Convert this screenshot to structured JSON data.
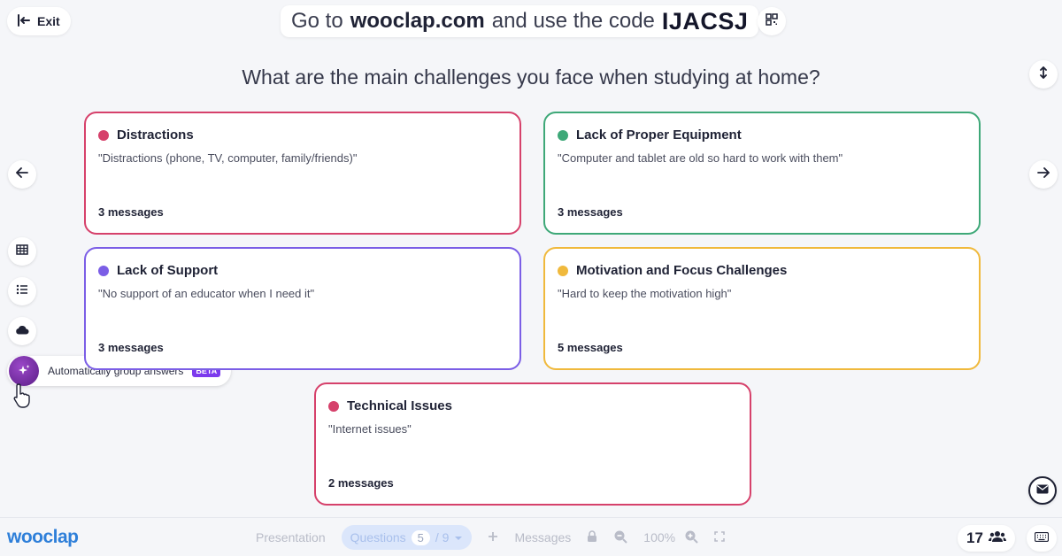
{
  "header": {
    "exit_label": "Exit",
    "code_prefix": "Go to",
    "code_site": "wooclap.com",
    "code_middle": "and use the code",
    "code": "IJACSJ"
  },
  "question": "What are the main challenges you face when studying at home?",
  "cards": [
    {
      "title": "Distractions",
      "quote": "\"Distractions (phone, TV, computer, family/friends)\"",
      "count": "3 messages",
      "color": "#d6416b"
    },
    {
      "title": "Lack of Proper Equipment",
      "quote": "\"Computer and tablet are old so hard to work with them\"",
      "count": "3 messages",
      "color": "#3ea878"
    },
    {
      "title": "Lack of Support",
      "quote": "\"No support of an educator when I need it\"",
      "count": "3 messages",
      "color": "#7b5ee6"
    },
    {
      "title": "Motivation and Focus Challenges",
      "quote": "\"Hard to keep the motivation high\"",
      "count": "5 messages",
      "color": "#f0b93c"
    },
    {
      "title": "Technical Issues",
      "quote": "\"Internet issues\"",
      "count": "2 messages",
      "color": "#d6416b"
    }
  ],
  "auto_group": {
    "label": "Automatically group answers",
    "badge": "BETA"
  },
  "bottom": {
    "logo": "wooclap",
    "presentation": "Presentation",
    "questions": "Questions",
    "current": "5",
    "total": "/ 9",
    "messages": "Messages",
    "zoom": "100%",
    "participants": "17"
  },
  "icons": [
    "exit-icon",
    "qr-code-icon",
    "expand-vertical-icon",
    "arrow-left-icon",
    "arrow-right-icon",
    "grid-icon",
    "list-icon",
    "cloud-icon",
    "sparkle-icon",
    "cursor-hand-icon",
    "mail-icon",
    "plus-icon",
    "lock-icon",
    "zoom-out-icon",
    "zoom-in-icon",
    "fullscreen-icon",
    "people-icon",
    "keyboard-icon"
  ]
}
